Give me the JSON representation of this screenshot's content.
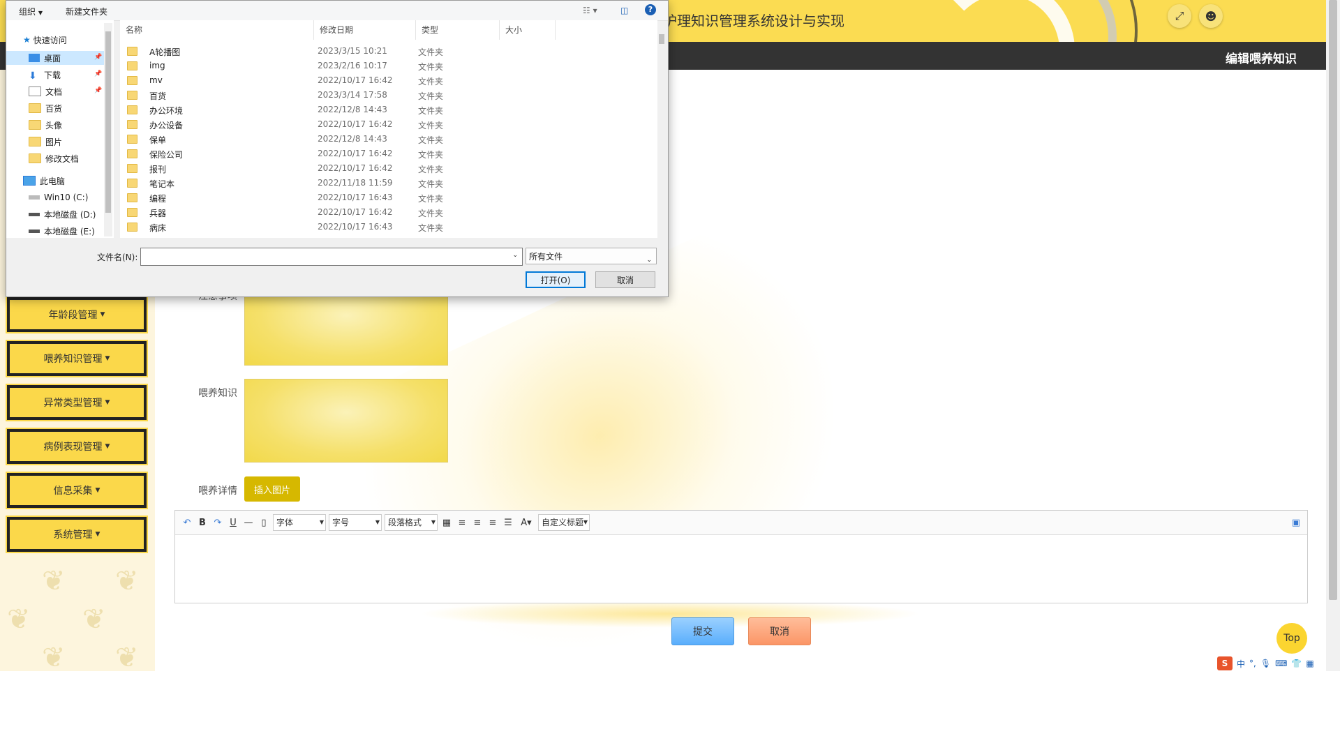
{
  "header": {
    "title": "护理知识管理系统设计与实现",
    "expand_icon": "expand-icon",
    "user_icon": "user-icon"
  },
  "navbar": {
    "right_title": "编辑喂养知识"
  },
  "sidebar": {
    "items": [
      {
        "label": "年龄段管理"
      },
      {
        "label": "喂养知识管理"
      },
      {
        "label": "异常类型管理"
      },
      {
        "label": "病例表现管理"
      },
      {
        "label": "信息采集"
      },
      {
        "label": "系统管理"
      }
    ]
  },
  "form": {
    "field1_label": "注意事项",
    "field2_label": "喂养知识",
    "field3_label": "喂养详情",
    "insert_image": "插入图片",
    "toolbar": {
      "font": "字体",
      "size": "字号",
      "paragraph": "段落格式",
      "custom": "自定义标题"
    },
    "submit": "提交",
    "cancel": "取消"
  },
  "top_button": "Top",
  "ime": {
    "lang": "中",
    "punct": "°,"
  },
  "dialog": {
    "toolbar": {
      "organize": "组织",
      "new_folder": "新建文件夹",
      "help": "?"
    },
    "nav": {
      "quick_access": "快速访问",
      "items": [
        {
          "label": "桌面",
          "pinned": true
        },
        {
          "label": "下载",
          "pinned": true
        },
        {
          "label": "文档",
          "pinned": true
        },
        {
          "label": "百货",
          "pinned": false
        },
        {
          "label": "头像",
          "pinned": false
        },
        {
          "label": "图片",
          "pinned": false
        },
        {
          "label": "修改文档",
          "pinned": false
        }
      ],
      "this_pc": "此电脑",
      "drives": [
        {
          "label": "Win10 (C:)"
        },
        {
          "label": "本地磁盘 (D:)"
        },
        {
          "label": "本地磁盘 (E:)"
        }
      ]
    },
    "columns": {
      "name": "名称",
      "modified": "修改日期",
      "type": "类型",
      "size": "大小"
    },
    "files": [
      {
        "name": "A轮播图",
        "modified": "2023/3/15 10:21",
        "type": "文件夹"
      },
      {
        "name": "img",
        "modified": "2023/2/16 10:17",
        "type": "文件夹"
      },
      {
        "name": "mv",
        "modified": "2022/10/17 16:42",
        "type": "文件夹"
      },
      {
        "name": "百货",
        "modified": "2023/3/14 17:58",
        "type": "文件夹"
      },
      {
        "name": "办公环境",
        "modified": "2022/12/8 14:43",
        "type": "文件夹"
      },
      {
        "name": "办公设备",
        "modified": "2022/10/17 16:42",
        "type": "文件夹"
      },
      {
        "name": "保单",
        "modified": "2022/12/8 14:43",
        "type": "文件夹"
      },
      {
        "name": "保险公司",
        "modified": "2022/10/17 16:42",
        "type": "文件夹"
      },
      {
        "name": "报刊",
        "modified": "2022/10/17 16:42",
        "type": "文件夹"
      },
      {
        "name": "笔记本",
        "modified": "2022/11/18 11:59",
        "type": "文件夹"
      },
      {
        "name": "编程",
        "modified": "2022/10/17 16:43",
        "type": "文件夹"
      },
      {
        "name": "兵器",
        "modified": "2022/10/17 16:42",
        "type": "文件夹"
      },
      {
        "name": "病床",
        "modified": "2022/10/17 16:43",
        "type": "文件夹"
      }
    ],
    "filename_label": "文件名(N):",
    "filename_value": "",
    "filetype": "所有文件",
    "open": "打开(O)",
    "cancel": "取消"
  }
}
